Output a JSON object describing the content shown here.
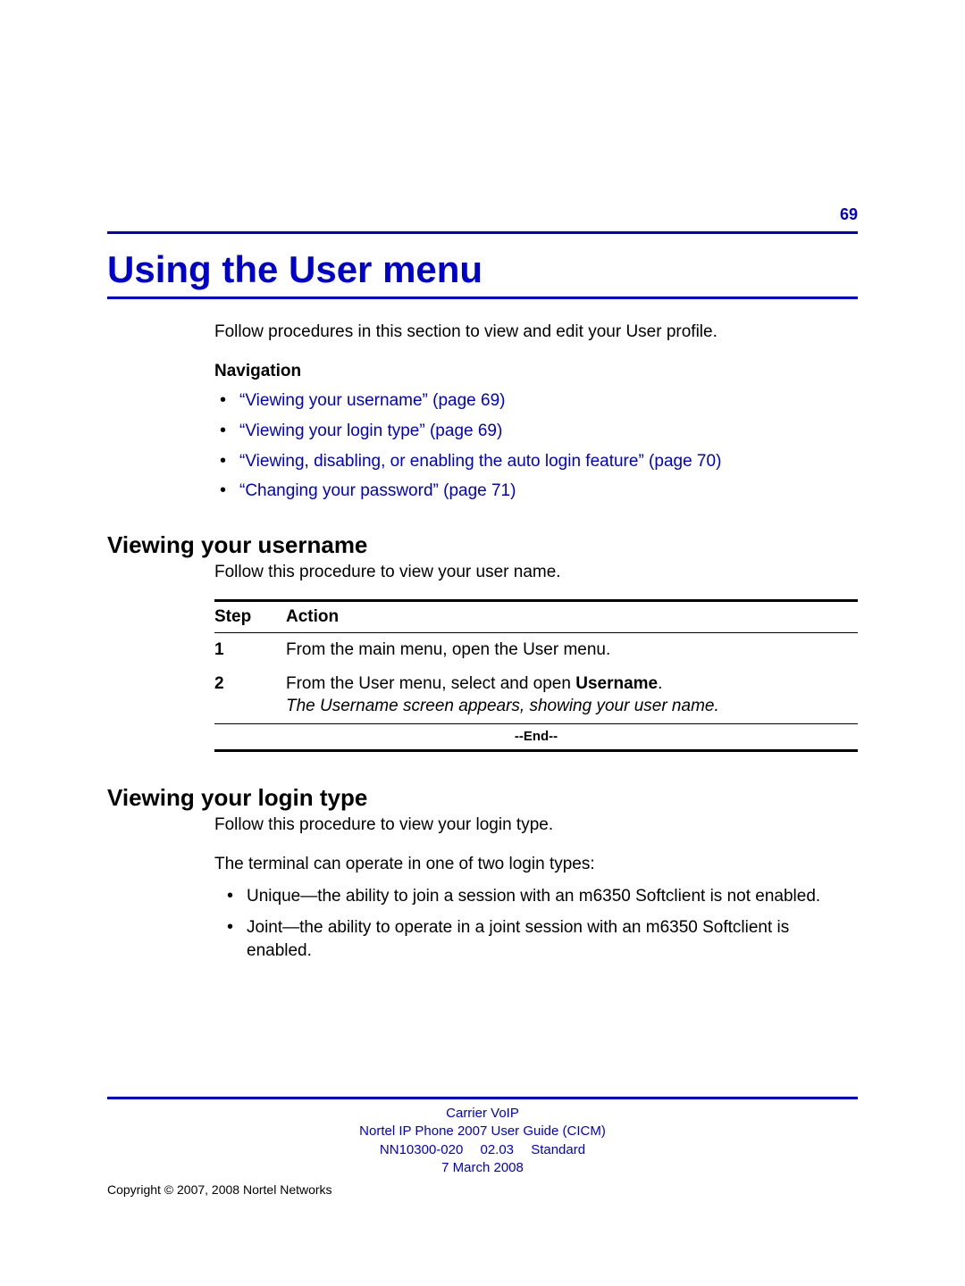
{
  "page_number": "69",
  "chapter_title": "Using the User menu",
  "intro": "Follow procedures in this section to view and edit your User profile.",
  "nav_heading": "Navigation",
  "nav_links": [
    "“Viewing your username” (page 69)",
    "“Viewing your login type” (page 69)",
    "“Viewing, disabling, or enabling the auto login feature” (page 70)",
    "“Changing your password” (page 71)"
  ],
  "section1": {
    "heading": "Viewing your username",
    "intro": "Follow this procedure to view your user name.",
    "table": {
      "step_label": "Step",
      "action_label": "Action",
      "rows": [
        {
          "num": "1",
          "text": "From the main menu, open the User menu."
        },
        {
          "num": "2",
          "text_pre": "From the User menu, select and open ",
          "text_bold": "Username",
          "text_post": ".",
          "italic": "The Username screen appears, showing your user name."
        }
      ],
      "end": "--End--"
    }
  },
  "section2": {
    "heading": "Viewing your login type",
    "intro": "Follow this procedure to view your login type.",
    "para": "The terminal can operate in one of two login types:",
    "bullets": [
      "Unique—the ability to join a session with an m6350 Softclient is not enabled.",
      "Joint—the ability to operate in a joint session with an m6350 Softclient is enabled."
    ]
  },
  "footer": {
    "line1": "Carrier VoIP",
    "line2": "Nortel IP Phone 2007 User Guide (CICM)",
    "line3": "NN10300-020  02.03  Standard",
    "line4": "7 March 2008",
    "copyright": "Copyright © 2007, 2008 Nortel Networks"
  }
}
